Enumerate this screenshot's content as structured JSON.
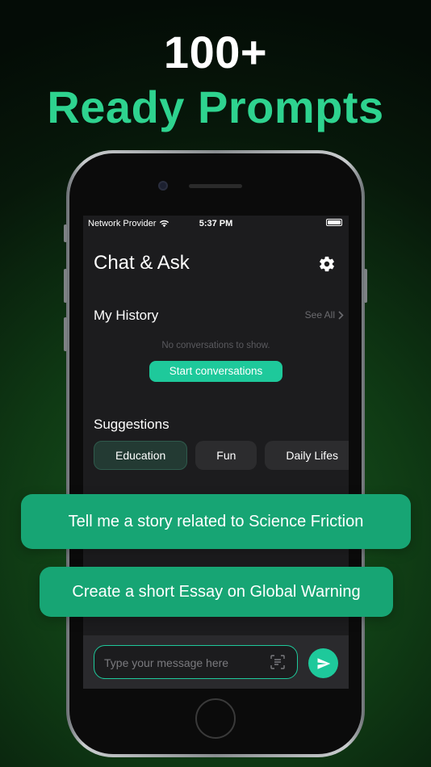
{
  "headline": {
    "line1": "100+",
    "line2": "Ready Prompts"
  },
  "status_bar": {
    "carrier": "Network Provider",
    "time": "5:37 PM"
  },
  "app": {
    "title": "Chat & Ask"
  },
  "history": {
    "title": "My History",
    "see_all": "See All",
    "empty_text": "No conversations to show.",
    "start_button": "Start conversations"
  },
  "suggestions": {
    "title": "Suggestions",
    "chips": [
      "Education",
      "Fun",
      "Daily Lifes"
    ]
  },
  "prompt_cards": [
    "Tell me a story related to Science Friction",
    "Create a short Essay on Global Warning"
  ],
  "input": {
    "placeholder": "Type your message here"
  },
  "colors": {
    "accent": "#1ec99b",
    "headline_green": "#2ed38f",
    "card_green": "#17a574",
    "screen_bg": "#1c1c1e"
  },
  "icons": [
    "wifi-icon",
    "battery-icon",
    "gear-icon",
    "chevron-right-icon",
    "scan-icon",
    "send-icon"
  ]
}
